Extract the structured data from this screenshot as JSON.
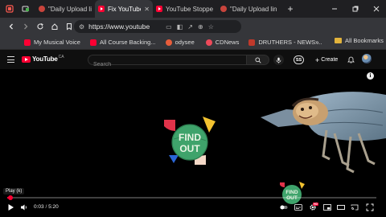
{
  "tabs": [
    {
      "label": "\"Daily Upload lin",
      "favicon": "record",
      "active": false
    },
    {
      "label": "Fix YouTube",
      "favicon": "youtube",
      "active": true
    },
    {
      "label": "YouTube Stoppe",
      "favicon": "youtube",
      "active": false
    },
    {
      "label": "\"Daily Upload lin",
      "favicon": "record",
      "active": false
    }
  ],
  "browser": {
    "url": "https://www.youtube",
    "new_tab": "+",
    "more": "»"
  },
  "bookmarks": [
    {
      "label": "My Musical Voice",
      "color": "#ff0033"
    },
    {
      "label": "All Course Backing...",
      "color": "#ff0033"
    },
    {
      "label": "odysee",
      "color": "#e85d3b"
    },
    {
      "label": "CDNews",
      "color": "#ee4a5a"
    },
    {
      "label": "DRUTHERS - NEWS ...",
      "color": "#c0392b"
    }
  ],
  "all_bookmarks": "All Bookmarks",
  "youtube": {
    "logo_text": "YouTube",
    "country": "CA",
    "search_placeholder": "Search",
    "ss_badge": "SS",
    "create_label": "Create"
  },
  "video": {
    "logo_text_line1": "FIND",
    "logo_text_line2": "OUT",
    "tooltip": "Play (k)",
    "current_time": "0:03",
    "separator": " / ",
    "duration": "5:20",
    "progress": 0.009,
    "hd_label": "HD"
  },
  "colors": {
    "accent": "#ff0033",
    "logo_green": "#3fa36b",
    "logo_yellow": "#f2c230",
    "logo_red": "#e0334a",
    "logo_blue": "#2a66d6"
  }
}
